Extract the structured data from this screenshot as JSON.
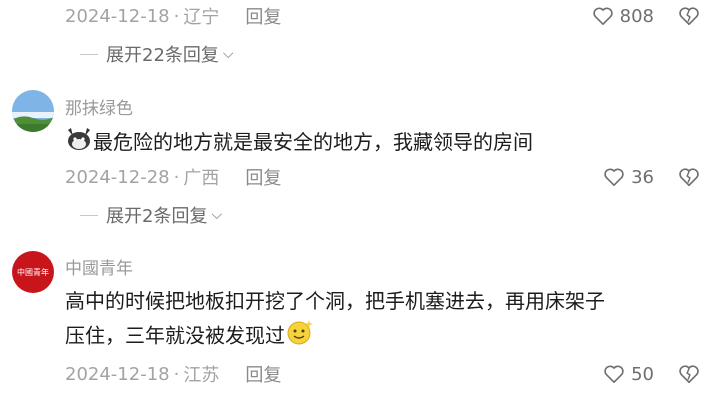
{
  "comments": [
    {
      "date": "2024-12-18",
      "region": "辽宁",
      "reply_label": "回复",
      "likes": "808",
      "expand_label": "展开22条回复"
    },
    {
      "username": "那抹绿色",
      "text": "最危险的地方就是最安全的地方，我藏领导的房间",
      "date": "2024-12-28",
      "region": "广西",
      "reply_label": "回复",
      "likes": "36",
      "expand_label": "展开2条回复"
    },
    {
      "username": "中國青年",
      "avatar_text": "中國青年",
      "text_line1": "高中的时候把地板扣开挖了个洞，把手机塞进去，再用床架子",
      "text_line2": "压住，三年就没被发现过",
      "date": "2024-12-18",
      "region": "江苏",
      "reply_label": "回复",
      "likes": "50"
    }
  ],
  "separator": "·",
  "icons": {
    "like": "heart-outline-icon",
    "dislike": "broken-heart-icon",
    "expand": "chevron-down-icon"
  }
}
